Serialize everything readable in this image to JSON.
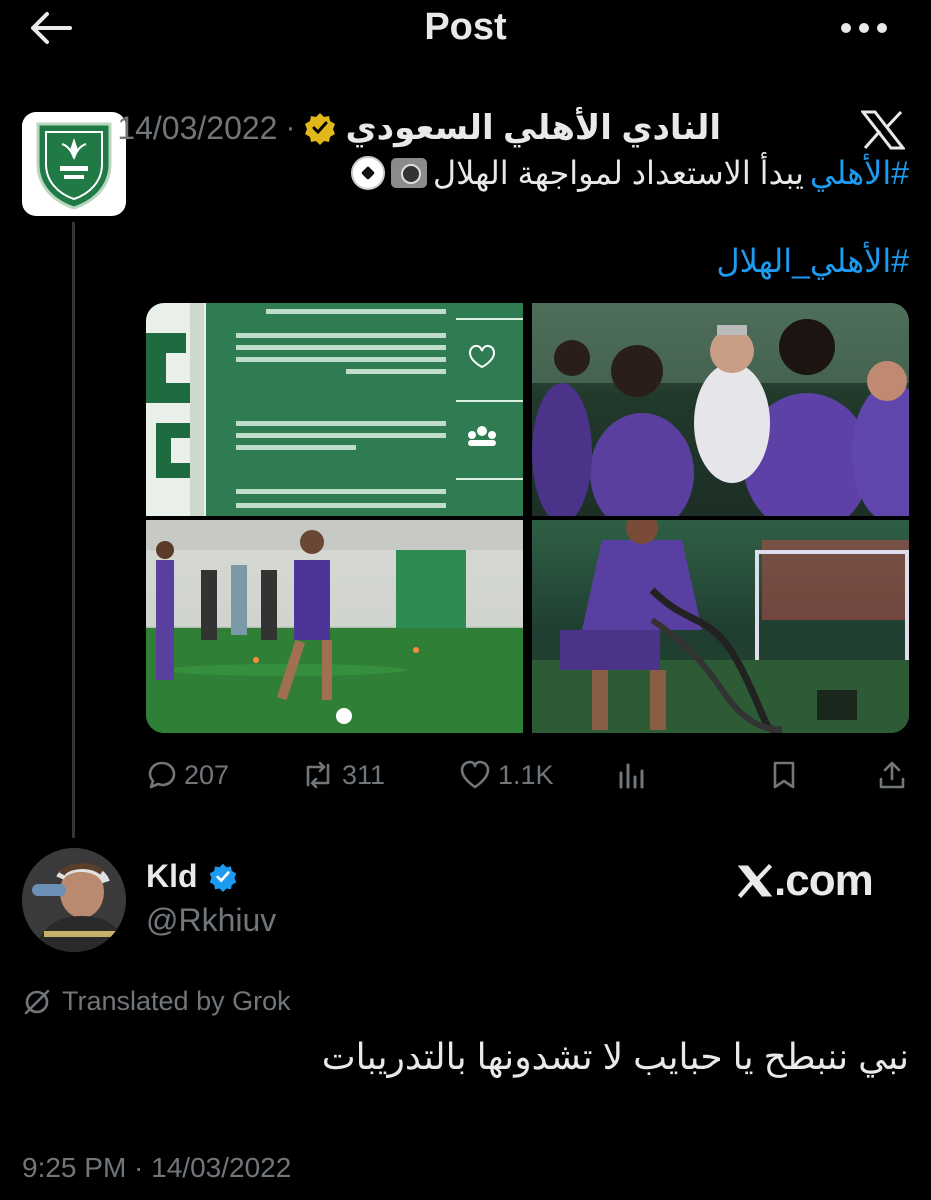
{
  "header": {
    "title": "Post"
  },
  "post": {
    "author_name": "النادي الأهلي السعودي",
    "date": "14/03/2022",
    "separator": "·",
    "text_hashtag": "#الأهلي",
    "text_body": "يبدأ الاستعداد لمواجهة الهلال",
    "hashtag_2": "#الأهلي_الهلال",
    "stats": {
      "replies": "207",
      "reposts": "311",
      "likes": "1.1K"
    }
  },
  "reply": {
    "name": "Kld",
    "handle": "@Rkhiuv",
    "watermark": ".com",
    "translated_label": "Translated by Grok",
    "text": "نبي ننبطح يا حبايب لا تشدونها بالتدريبات",
    "timestamp": "9:25 PM · 14/03/2022"
  },
  "colors": {
    "background": "#000000",
    "text": "#e7e9ea",
    "muted": "#71767b",
    "link": "#1d9bf0",
    "verified_gold": "#e2b719",
    "verified_blue": "#1d9bf0"
  },
  "icons": [
    "back-arrow-icon",
    "more-dots-icon",
    "x-logo-icon",
    "verified-gold-icon",
    "camera-flash-emoji",
    "soccer-ball-emoji",
    "reply-icon",
    "repost-icon",
    "like-icon",
    "views-icon",
    "bookmark-icon",
    "share-icon",
    "verified-blue-icon",
    "grok-icon"
  ]
}
